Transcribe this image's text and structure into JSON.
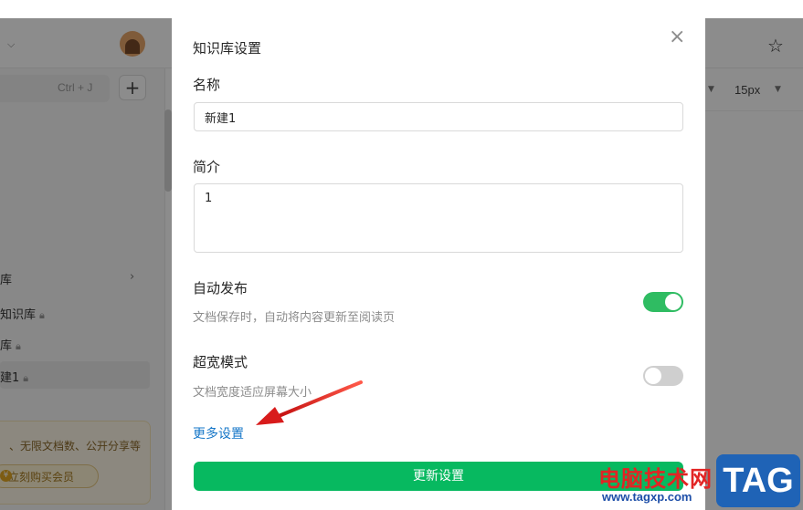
{
  "background": {
    "shortcut": "Ctrl + J",
    "font_size": "15px",
    "sidebar_items": [
      {
        "label": "库"
      },
      {
        "label": "知识库"
      },
      {
        "label": "库"
      },
      {
        "label": "建1"
      }
    ],
    "promo_text": "、无限文档数、公开分享等",
    "promo_button": "立刻购买会员"
  },
  "modal": {
    "title": "知识库设置",
    "close_glyph": "×",
    "name_label": "名称",
    "name_value": "新建1",
    "intro_label": "简介",
    "intro_value": "1",
    "auto_publish": {
      "label": "自动发布",
      "description": "文档保存时，自动将内容更新至阅读页",
      "enabled": true
    },
    "wide_mode": {
      "label": "超宽模式",
      "description": "文档宽度适应屏幕大小",
      "enabled": false
    },
    "more_settings": "更多设置",
    "submit": "更新设置"
  },
  "watermark": {
    "site_name": "电脑技术网",
    "url": "www.tagxp.com",
    "badge": "TAG"
  },
  "colors": {
    "accent_green": "#07b960",
    "toggle_on": "#2fbc62",
    "link_blue": "#1677c8",
    "annotation_red": "#e01f1f"
  }
}
